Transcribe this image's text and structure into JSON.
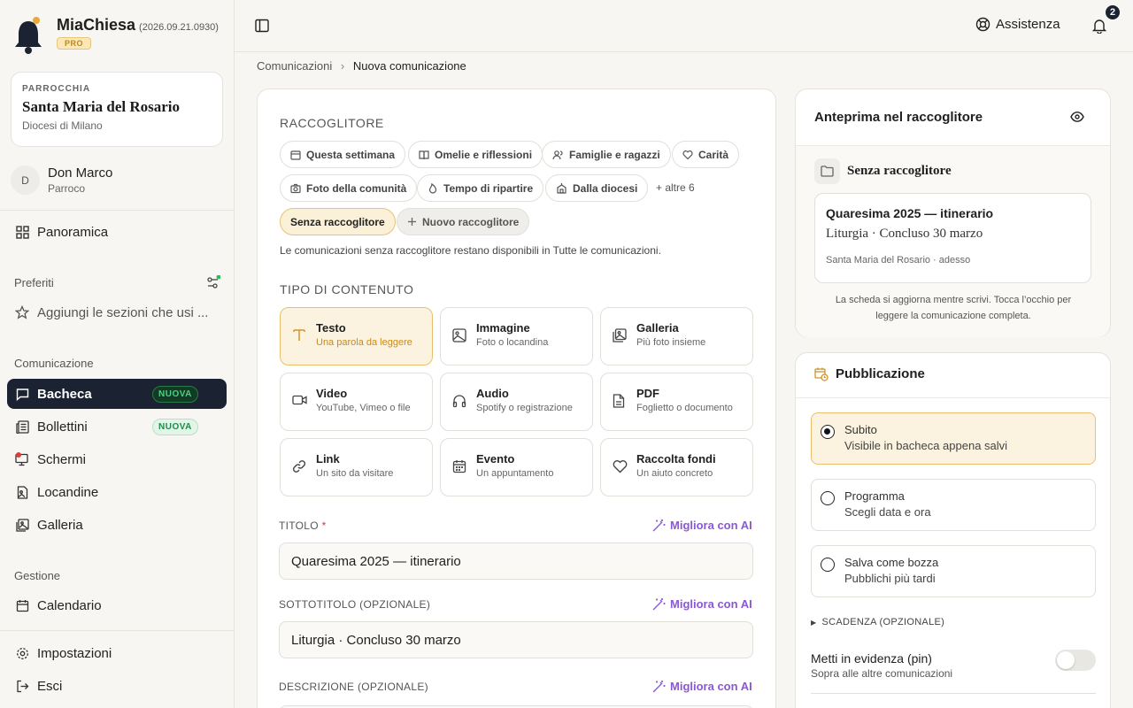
{
  "app": {
    "name": "MiaChiesa",
    "version": "(2026.09.21.0930)",
    "plan": "PRO"
  },
  "parish": {
    "tag": "PARROCCHIA",
    "name": "Santa Maria del Rosario",
    "diocese": "Diocesi di Milano"
  },
  "user": {
    "initial": "D",
    "name": "Don Marco",
    "role": "Parroco"
  },
  "sidebar": {
    "overview": "Panoramica",
    "favorites_label": "Preferiti",
    "favorites_hint": "Aggiungi le sezioni che usi ...",
    "comm_label": "Comunicazione",
    "comm_items": [
      {
        "label": "Bacheca",
        "badge": "NUOVA"
      },
      {
        "label": "Bollettini",
        "badge": "NUOVA"
      },
      {
        "label": "Schermi"
      },
      {
        "label": "Locandine"
      },
      {
        "label": "Galleria"
      }
    ],
    "manage_label": "Gestione",
    "calendar": "Calendario",
    "settings": "Impostazioni",
    "logout": "Esci"
  },
  "topbar": {
    "help": "Assistenza",
    "notifications": "2"
  },
  "breadcrumb": {
    "parent": "Comunicazioni",
    "current": "Nuova comunicazione"
  },
  "form": {
    "collector_label": "RACCOGLITORE",
    "chips": [
      "Questa settimana",
      "Omelie e riflessioni",
      "Famiglie e ragazzi",
      "Carità",
      "Foto della comunità",
      "Tempo di ripartire",
      "Dalla diocesi"
    ],
    "more_chips": "+ altre 6",
    "no_collector": "Senza raccoglitore",
    "new_collector": "Nuovo raccoglitore",
    "collector_hint": "Le comunicazioni senza raccoglitore restano disponibili in Tutte le comunicazioni.",
    "type_label": "TIPO DI CONTENUTO",
    "types": [
      {
        "title": "Testo",
        "sub": "Una parola da leggere"
      },
      {
        "title": "Immagine",
        "sub": "Foto o locandina"
      },
      {
        "title": "Galleria",
        "sub": "Più foto insieme"
      },
      {
        "title": "Video",
        "sub": "YouTube, Vimeo o file"
      },
      {
        "title": "Audio",
        "sub": "Spotify o registrazione"
      },
      {
        "title": "PDF",
        "sub": "Foglietto o documento"
      },
      {
        "title": "Link",
        "sub": "Un sito da visitare"
      },
      {
        "title": "Evento",
        "sub": "Un appuntamento"
      },
      {
        "title": "Raccolta fondi",
        "sub": "Un aiuto concreto"
      }
    ],
    "title_label": "TITOLO",
    "required_mark": "*",
    "title_value": "Quaresima 2025 — itinerario",
    "subtitle_label": "SOTTOTITOLO (OPZIONALE)",
    "subtitle_value": "Liturgia · Concluso 30 marzo",
    "desc_label": "DESCRIZIONE (OPZIONALE)",
    "ai_label": "Migliora con AI"
  },
  "preview": {
    "title": "Anteprima nel raccoglitore",
    "collector": "Senza raccoglitore",
    "card_title": "Quaresima 2025 — itinerario",
    "card_sub": "Liturgia · Concluso 30 marzo",
    "card_meta": "Santa Maria del Rosario · adesso",
    "hint": "La scheda si aggiorna mentre scrivi. Tocca l’occhio per leggere la comunicazione completa."
  },
  "publish": {
    "title": "Pubblicazione",
    "options": [
      {
        "title": "Subito",
        "sub": "Visibile in bacheca appena salvi"
      },
      {
        "title": "Programma",
        "sub": "Scegli data e ora"
      },
      {
        "title": "Salva come bozza",
        "sub": "Pubblichi più tardi"
      }
    ],
    "expiry": "SCADENZA (OPZIONALE)",
    "pin_title": "Metti in evidenza (pin)",
    "pin_sub": "Sopra alle altre comunicazioni"
  }
}
